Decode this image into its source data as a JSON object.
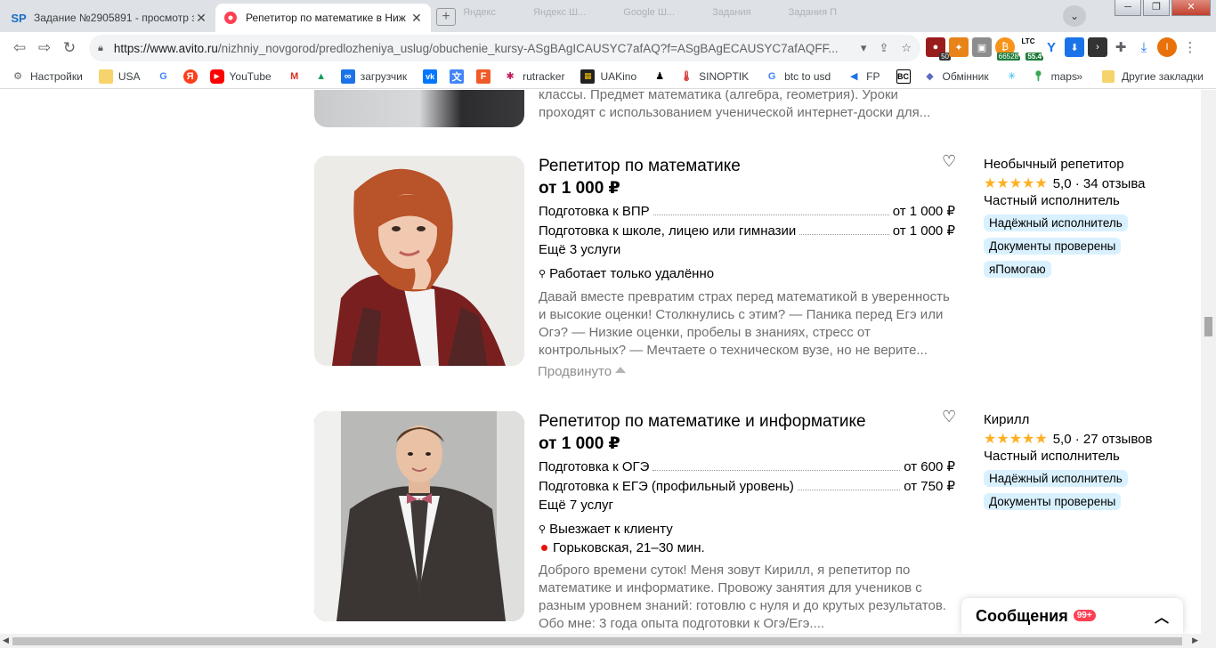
{
  "browser": {
    "tabs": [
      {
        "title": "Задание №2905891 - просмотр з",
        "favicon": "SP",
        "active": false
      },
      {
        "title": "Репетитор по математике в Ниж",
        "favicon": "avito",
        "active": true
      }
    ],
    "faded_tabs": [
      "Яндекс",
      "Яндекс Ш...",
      "Google Ш...",
      "Задания",
      "Задания П"
    ],
    "address": {
      "host": "https://www.avito.ru",
      "path": "/nizhniy_novgorod/predlozheniya_uslug/obuchenie_kursy-ASgBAgICAUSYC7afAQ?f=ASgBAgECAUSYC7afAQFF..."
    },
    "extensions": [
      {
        "icon": "lastpass-icon",
        "badge": "50",
        "color": "#9b1c1c"
      },
      {
        "icon": "brave-icon",
        "badge": "",
        "color": "#e8831a"
      },
      {
        "icon": "briefcase-icon",
        "badge": "",
        "color": "#8d8d8d"
      },
      {
        "icon": "btc-icon",
        "badge": "66528",
        "color": "#f7931a"
      },
      {
        "icon": "ltc-icon",
        "badge": "55.4",
        "label": "LTC",
        "color": "#1e7d3a"
      },
      {
        "icon": "y-icon",
        "badge": "",
        "color": "#1a73e8"
      },
      {
        "icon": "download-icon",
        "badge": "",
        "color": "#1a73e8"
      },
      {
        "icon": "terminal-icon",
        "badge": "",
        "color": "#333"
      },
      {
        "icon": "puzzle-icon",
        "badge": "",
        "color": "#5f6368"
      },
      {
        "icon": "download-arrow-icon",
        "badge": "",
        "color": "#1a73e8"
      },
      {
        "icon": "profile-icon",
        "badge": "",
        "color": "#e8710a"
      }
    ],
    "bookmarks": [
      {
        "label": "Настройки",
        "icon": "gear-icon"
      },
      {
        "label": "USA",
        "icon": "folder-icon"
      },
      {
        "label": "",
        "icon": "google-icon"
      },
      {
        "label": "",
        "icon": "yandex-icon"
      },
      {
        "label": "YouTube",
        "icon": "youtube-icon"
      },
      {
        "label": "",
        "icon": "gmail-icon"
      },
      {
        "label": "",
        "icon": "drive-icon"
      },
      {
        "label": "загрузчик",
        "icon": "infinity-icon"
      },
      {
        "label": "",
        "icon": "vk-icon"
      },
      {
        "label": "",
        "icon": "translate-icon"
      },
      {
        "label": "",
        "icon": "f-icon"
      },
      {
        "label": "rutracker",
        "icon": "rutracker-icon"
      },
      {
        "label": "UAKino",
        "icon": "film-icon"
      },
      {
        "label": "",
        "icon": "person-icon"
      },
      {
        "label": "SINOPTIK",
        "icon": "thermometer-icon"
      },
      {
        "label": "btc to usd",
        "icon": "google-icon"
      },
      {
        "label": "FP",
        "icon": "fp-icon"
      },
      {
        "label": "",
        "icon": "bc-icon"
      },
      {
        "label": "Обмінник",
        "icon": "diamond-icon"
      },
      {
        "label": "",
        "icon": "snowflake-icon"
      },
      {
        "label": "maps",
        "icon": "maps-icon"
      }
    ],
    "bookmarks_more": "»",
    "other_bookmarks": "Другие закладки"
  },
  "listings": {
    "top_partial": {
      "desc_line1": "классы. Предмет математика (алгебра, геометрия). Уроки",
      "desc_line2": "проходят с использованием ученической интернет-доски для..."
    },
    "items": [
      {
        "title": "Репетитор по математике",
        "price": "от 1 000 ₽",
        "services": [
          {
            "name": "Подготовка к ВПР",
            "price": "от 1 000 ₽"
          },
          {
            "name": "Подготовка к школе, лицею или гимназии",
            "price": "от 1 000 ₽"
          }
        ],
        "more_services": "Ещё 3 услуги",
        "location": "Работает только удалённо",
        "description": "Давай вместе превратим страх перед математикой в уверенность и высокие оценки! Столкнулись с этим? — Паника перед Егэ или Огэ? — Низкие оценки, пробелы в знаниях, стресс от контрольных? — Мечтаете о техническом вузе, но не верите...",
        "promoted": "Продвинуто",
        "seller": "Необычный репетитор",
        "rating": "5,0",
        "reviews": "34 отзыва",
        "seller_type": "Частный исполнитель",
        "badges": [
          "Надёжный исполнитель",
          "Документы проверены",
          "яПомогаю"
        ]
      },
      {
        "title": "Репетитор по математике и информатике",
        "price": "от 1 000 ₽",
        "services": [
          {
            "name": "Подготовка к ОГЭ",
            "price": "от 600 ₽"
          },
          {
            "name": "Подготовка к ЕГЭ (профильный уровень)",
            "price": "от 750 ₽"
          }
        ],
        "more_services": "Ещё 7 услуг",
        "location": "Выезжает к клиенту",
        "metro": "Горьковская, 21–30 мин.",
        "description": "Доброго времени суток! Меня зовут Кирилл, я репетитор по математике и информатике. Провожу занятия для учеников с разным уровнем знаний: готовлю с нуля и до крутых результатов. Обо мне: 3 года опыта подготовки к Огэ/Егэ....",
        "seller": "Кирилл",
        "rating": "5,0",
        "reviews": "27 отзывов",
        "seller_type": "Частный исполнитель",
        "badges": [
          "Надёжный исполнитель",
          "Документы проверены"
        ]
      }
    ]
  },
  "messages": {
    "label": "Сообщения",
    "count": "99+"
  },
  "colors": {
    "star": "#ffb021",
    "badge_bg": "#d9f1ff",
    "metro_red": "#e8120c",
    "unread_red": "#ff4053"
  }
}
